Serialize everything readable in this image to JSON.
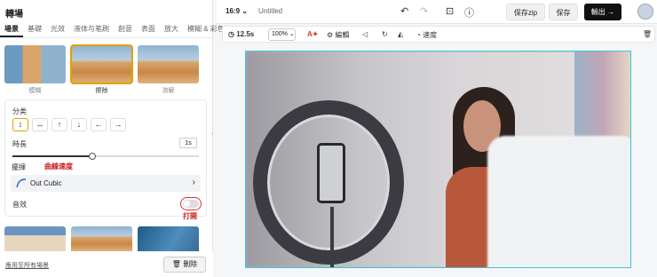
{
  "left_panel": {
    "title": "轉場",
    "tabs": [
      "場景",
      "基礎",
      "光效",
      "液体与笔刷",
      "創意",
      "表面",
      "放大",
      "模糊 & 彩色"
    ],
    "thumbnails": [
      {
        "label": "模糊"
      },
      {
        "label": "擦除"
      },
      {
        "label": "溶解"
      }
    ],
    "direction_label": "分类",
    "directions": [
      "↕",
      "↔",
      "↑",
      "↓",
      "←",
      "→"
    ],
    "duration_label": "時長",
    "duration_value": "1s",
    "duration_progress": 0.43,
    "easing_label": "擺揮",
    "easing_value": "Out Cubic",
    "sound_label": "音效",
    "annotation_curve": "曲線速度",
    "annotation_toggle": "打開",
    "apply_all": "應用至所有場景",
    "delete_label": "刪除"
  },
  "top_bar": {
    "ratio": "16:9",
    "title": "Untitled",
    "save_zip": "保存zip",
    "save": "保存",
    "export": "輸出"
  },
  "toolbar": {
    "duration": "12.5s",
    "zoom": "100%",
    "edit": "編輯",
    "speed": "速度"
  },
  "colors": {
    "accent": "#e0a300",
    "annotation": "#c81a1a",
    "canvas_border": "#3ac6e0"
  }
}
